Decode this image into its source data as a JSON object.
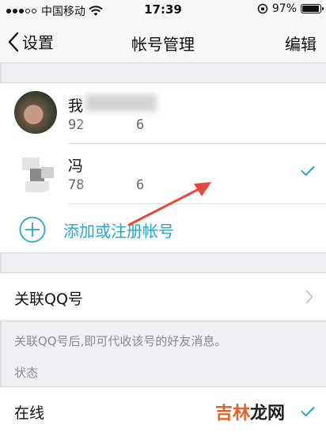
{
  "status_bar": {
    "carrier": "中国移动",
    "time": "17:39",
    "battery_percent": "97%",
    "battery_level": 0.97
  },
  "nav": {
    "back_label": "设置",
    "title": "帐号管理",
    "edit_label": "编辑"
  },
  "accounts": [
    {
      "name": "我",
      "id": "92",
      "id_tail": "6",
      "selected": false
    },
    {
      "name": "冯",
      "id": "78",
      "id_tail": "6",
      "selected": true
    }
  ],
  "add_account_label": "添加或注册帐号",
  "link_qq": {
    "label": "关联QQ号",
    "note": "关联QQ号后,即可代收该号的好友消息。"
  },
  "status_section": {
    "header": "状态",
    "current": "在线"
  },
  "watermark": {
    "text_colored": "吉林",
    "text_dark": "龙网"
  },
  "colors": {
    "accent": "#2aa5c9",
    "arrow": "#e8483a",
    "watermark": "#e0622a"
  },
  "icons": {
    "back": "chevron-left-icon",
    "check": "checkmark-icon",
    "add": "plus-circle-icon",
    "chevron": "chevron-right-icon"
  }
}
